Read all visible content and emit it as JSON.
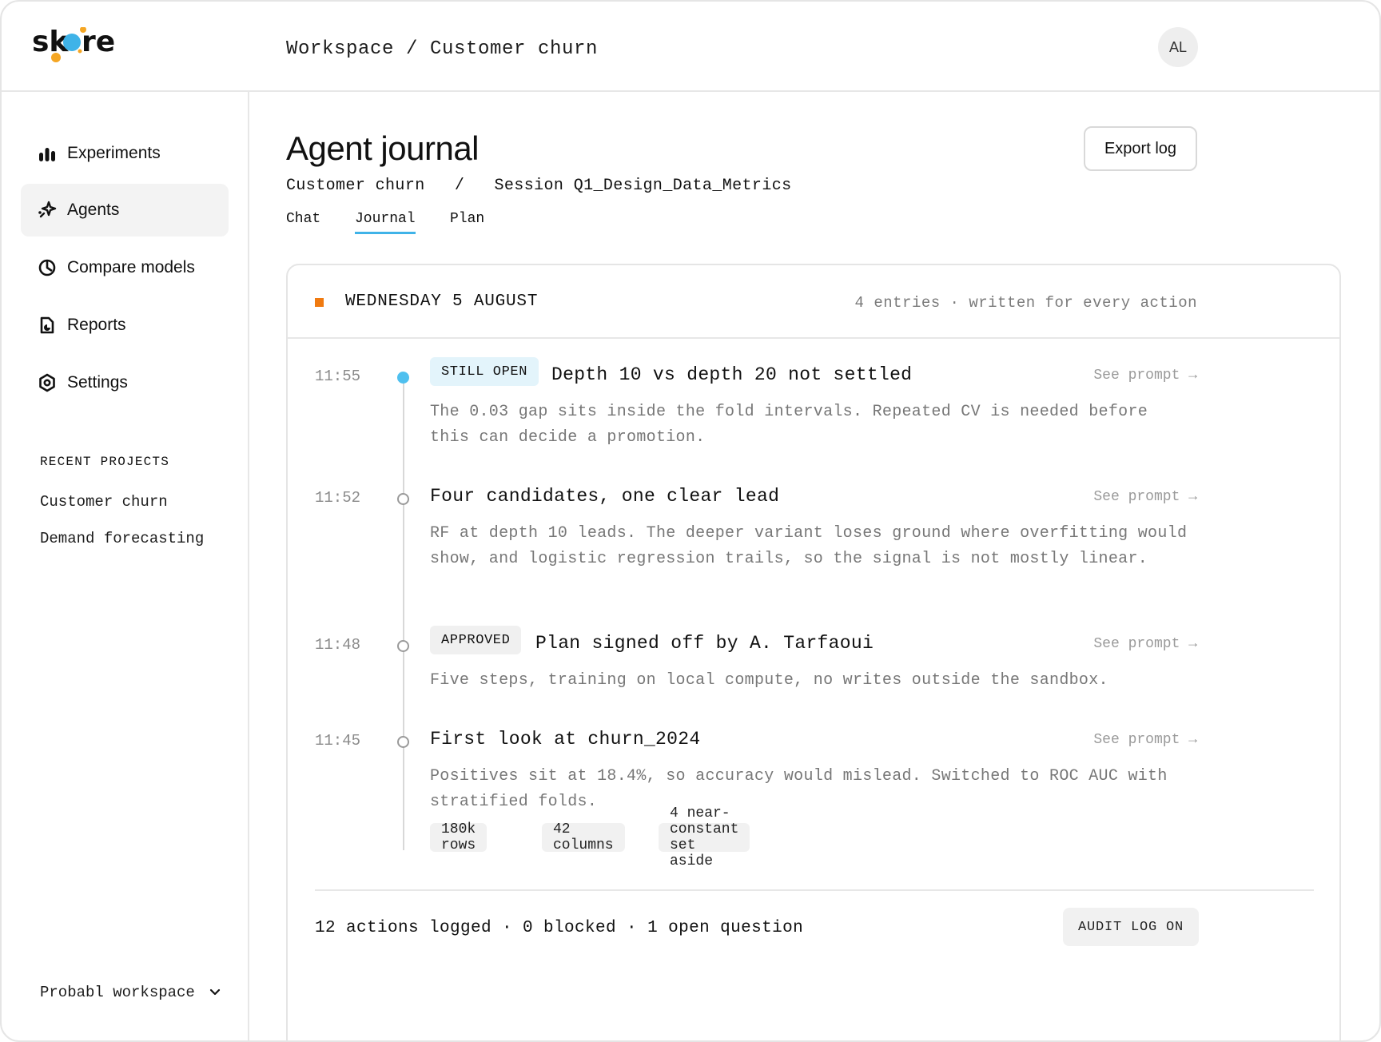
{
  "app": {
    "logo_text": "skore",
    "breadcrumb": "Workspace / Customer churn",
    "avatar_initials": "AL",
    "brand_colors": {
      "blue": "#3fb3e8",
      "orange": "#f5a623"
    }
  },
  "sidebar": {
    "items": [
      {
        "label": "Experiments",
        "icon": "bar-chart-icon",
        "active": false
      },
      {
        "label": "Agents",
        "icon": "sparkle-icon",
        "active": true
      },
      {
        "label": "Compare models",
        "icon": "pie-chart-icon",
        "active": false
      },
      {
        "label": "Reports",
        "icon": "report-icon",
        "active": false
      },
      {
        "label": "Settings",
        "icon": "settings-gear-icon",
        "active": false
      }
    ],
    "recent_title": "RECENT PROJECTS",
    "recent": [
      "Customer churn",
      "Demand forecasting"
    ],
    "workspace": "Probabl workspace"
  },
  "main": {
    "title": "Agent journal",
    "export_label": "Export log",
    "crumb": {
      "project": "Customer churn",
      "separator": "/",
      "session": "Session Q1_Design_Data_Metrics"
    },
    "tabs": [
      {
        "label": "Chat",
        "active": false
      },
      {
        "label": "Journal",
        "active": true
      },
      {
        "label": "Plan",
        "active": false
      }
    ]
  },
  "journal": {
    "day": "WEDNESDAY 5 AUGUST",
    "meta": "4 entries · written for every action",
    "entries": [
      {
        "time": "11:55",
        "badge": "STILL OPEN",
        "title": "Depth 10 vs depth 20 not settled",
        "link": "See prompt →",
        "body": "The 0.03 gap sits inside the fold intervals. Repeated CV is needed before this can decide a promotion."
      },
      {
        "time": "11:52",
        "title": "Four candidates, one clear lead",
        "link": "See prompt →",
        "body": "RF at depth 10 leads. The deeper variant loses ground where overfitting would show, and logistic regression trails, so the signal is not mostly linear."
      },
      {
        "time": "11:48",
        "badge": "APPROVED",
        "title": "Plan signed off by A. Tarfaoui",
        "link": "See prompt →",
        "body": "Five steps, training on local compute, no writes outside the sandbox."
      },
      {
        "time": "11:45",
        "title": "First look at churn_2024",
        "link": "See prompt →",
        "body": "Positives sit at 18.4%, so accuracy would mislead. Switched to ROC AUC with stratified folds.",
        "chips": [
          "180k rows",
          "42 columns",
          "4 near-constant set aside"
        ]
      }
    ],
    "footer": "12 actions logged · 0 blocked · 1 open question",
    "audit_label": "AUDIT LOG ON"
  }
}
